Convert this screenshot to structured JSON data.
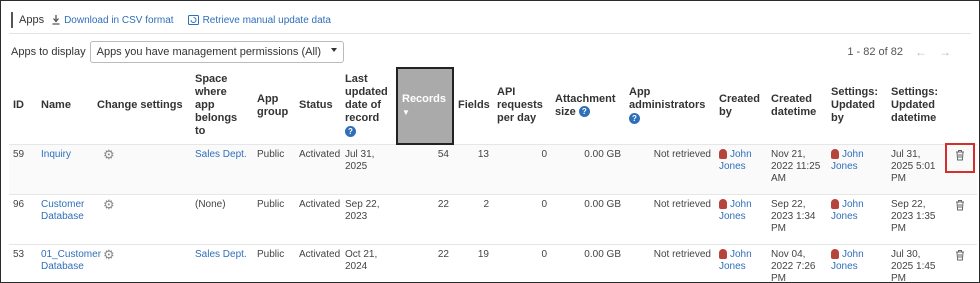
{
  "header": {
    "title": "Apps",
    "csv_link": "Download in CSV format",
    "retrieve_link": "Retrieve manual update data"
  },
  "filter": {
    "label": "Apps to display",
    "selected": "Apps you have management permissions (All)"
  },
  "pager": {
    "text": "1 - 82 of 82"
  },
  "columns": {
    "id": "ID",
    "name": "Name",
    "change_settings": "Change settings",
    "space": "Space where app belongs to",
    "app_group": "App group",
    "status": "Status",
    "last_updated": "Last updated date of record",
    "records": "Records",
    "fields": "Fields",
    "api_requests": "API requests per day",
    "attachment": "Attachment size",
    "app_admins": "App administrators",
    "created_by": "Created by",
    "created_datetime": "Created datetime",
    "settings_updated_by": "Settings: Updated by",
    "settings_updated_datetime": "Settings: Updated datetime"
  },
  "rows": [
    {
      "id": "59",
      "name": "Inquiry",
      "space": "Sales Dept.",
      "group": "Public",
      "status": "Activated",
      "last_updated": "Jul 31, 2025",
      "records": "54",
      "fields": "13",
      "api": "0",
      "attachment": "0.00 GB",
      "admins": "Not retrieved",
      "created_by": "John Jones",
      "created": "Nov 21, 2022 11:25 AM",
      "updated_by": "John Jones",
      "updated": "Jul 31, 2025 5:01 PM"
    },
    {
      "id": "96",
      "name": "Customer Database",
      "space": "(None)",
      "group": "Public",
      "status": "Activated",
      "last_updated": "Sep 22, 2023",
      "records": "22",
      "fields": "2",
      "api": "0",
      "attachment": "0.00 GB",
      "admins": "Not retrieved",
      "created_by": "John Jones",
      "created": "Sep 22, 2023 1:34 PM",
      "updated_by": "John Jones",
      "updated": "Sep 22, 2023 1:35 PM"
    },
    {
      "id": "53",
      "name": "01_Customer Database",
      "space": "Sales Dept.",
      "group": "Public",
      "status": "Activated",
      "last_updated": "Oct 21, 2024",
      "records": "22",
      "fields": "19",
      "api": "0",
      "attachment": "0.00 GB",
      "admins": "Not retrieved",
      "created_by": "John Jones",
      "created": "Nov 04, 2022 7:26 PM",
      "updated_by": "John Jones",
      "updated": "Jul 30, 2025 1:45 PM"
    }
  ]
}
